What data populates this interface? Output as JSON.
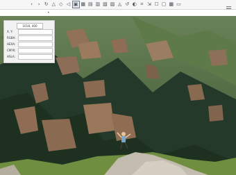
{
  "toolbar": {
    "tools": [
      {
        "icon": "chevron-left-icon",
        "glyph": "‹"
      },
      {
        "icon": "chevron-right-icon",
        "glyph": "›"
      },
      {
        "icon": "rotate-icon",
        "glyph": "↻"
      },
      {
        "icon": "warning-icon",
        "glyph": "△"
      },
      {
        "icon": "shape-icon",
        "glyph": "◇"
      },
      {
        "icon": "triangle-left-icon",
        "glyph": "◁"
      },
      {
        "icon": "select-box-icon",
        "glyph": "▣"
      },
      {
        "icon": "grid-icon",
        "glyph": "▦"
      },
      {
        "icon": "layers-icon",
        "glyph": "▤"
      },
      {
        "icon": "image-icon",
        "glyph": "▥"
      },
      {
        "icon": "stack-icon",
        "glyph": "▧"
      },
      {
        "icon": "table-icon",
        "glyph": "▨"
      },
      {
        "icon": "fill-icon",
        "glyph": "◬"
      },
      {
        "icon": "refresh-icon",
        "glyph": "↺"
      },
      {
        "icon": "adjust-icon",
        "glyph": "◐"
      },
      {
        "icon": "crop-icon",
        "glyph": "⌗"
      },
      {
        "icon": "export-icon",
        "glyph": "⇲"
      },
      {
        "icon": "comment-icon",
        "glyph": "☐"
      },
      {
        "icon": "frame-icon",
        "glyph": "▢"
      },
      {
        "icon": "gallery-icon",
        "glyph": "▩"
      },
      {
        "icon": "panel-icon",
        "glyph": "▭"
      }
    ],
    "menu_icon": "hamburger-menu-icon"
  },
  "color_panel": {
    "coordinates": "1018, 400",
    "fields": [
      {
        "label": "X, Y:",
        "value": ""
      },
      {
        "label": "RGBA:",
        "value": ""
      },
      {
        "label": "HEXA:",
        "value": ""
      },
      {
        "label": "CMYK:",
        "value": ""
      },
      {
        "label": "HSLA:",
        "value": ""
      }
    ]
  },
  "colors": {
    "toolbar_bg": "#f6f6f7",
    "mountain_green": "#4d6b3c",
    "dark_forest": "#223726",
    "field_brown": "#8f6d55"
  }
}
